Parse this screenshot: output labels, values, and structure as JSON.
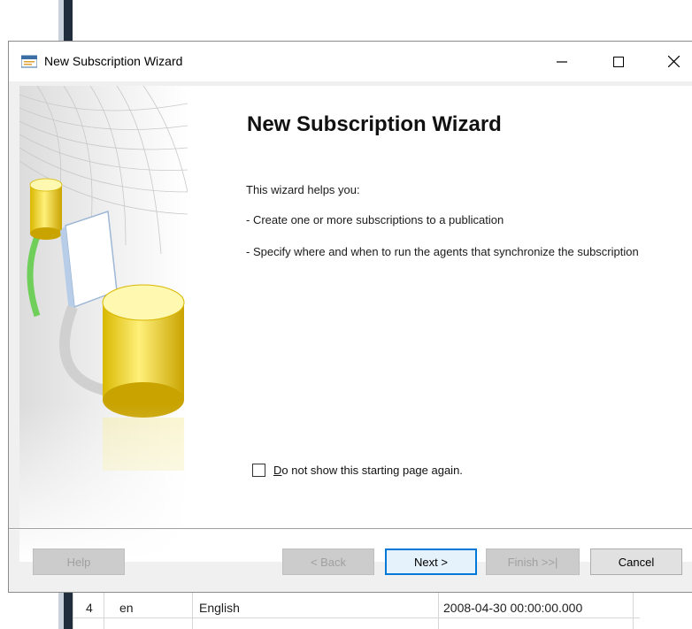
{
  "window": {
    "title": "New Subscription Wizard",
    "minimize_glyph": "—",
    "maximize_glyph": "☐",
    "close_glyph": "✕"
  },
  "page": {
    "heading": "New Subscription Wizard",
    "intro": "This wizard helps you:",
    "bullet_1": " - Create one or more subscriptions to a publication",
    "bullet_2": " - Specify where and when to run the agents that synchronize the subscription"
  },
  "checkbox": {
    "label_prefix": "D",
    "label_rest": "o not show this starting page again.",
    "checked": false
  },
  "buttons": {
    "help": "Help",
    "back": "< Back",
    "next": "Next >",
    "finish": "Finish >>|",
    "cancel": "Cancel"
  },
  "background_grid": {
    "row": {
      "index": "4",
      "code": "en",
      "language": "English",
      "date": "2008-04-30 00:00:00.000"
    }
  },
  "colors": {
    "accent": "#0078d7",
    "cylinder": "#f2d80a"
  }
}
